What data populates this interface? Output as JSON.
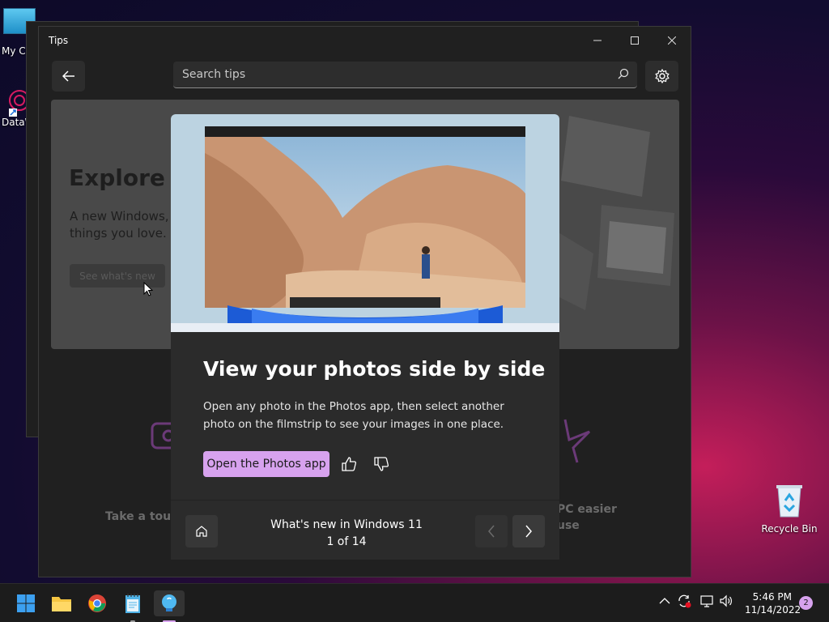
{
  "desktop": {
    "icons": [
      {
        "label": "My Co"
      },
      {
        "label": "DataW"
      },
      {
        "label": "Recycle Bin"
      }
    ]
  },
  "window": {
    "title": "Tips",
    "controls": {
      "minimize": "—",
      "maximize": "☐",
      "close": "✕"
    }
  },
  "toolbar": {
    "search_placeholder": "Search tips"
  },
  "hero": {
    "title": "Explore W",
    "text": "A new Windows, things you love.",
    "button": "See what's new"
  },
  "tiles": {
    "tour_label": "Take a tour",
    "pc_label_line1": "PC easier",
    "pc_label_line2": "use"
  },
  "card": {
    "title": "View your photos side by side",
    "description": "Open any photo in the Photos app, then select another photo on the filmstrip to see your images in one place.",
    "primary_button": "Open the Photos app",
    "nav": {
      "collection": "What's new in Windows 11",
      "position": "1 of 14"
    }
  },
  "taskbar": {
    "clock_time": "5:46 PM",
    "clock_date": "11/14/2022",
    "notification_count": "2"
  },
  "colors": {
    "accent": "#d7a2ee",
    "card_bg": "#2b2b2b",
    "window_bg": "#202020"
  }
}
